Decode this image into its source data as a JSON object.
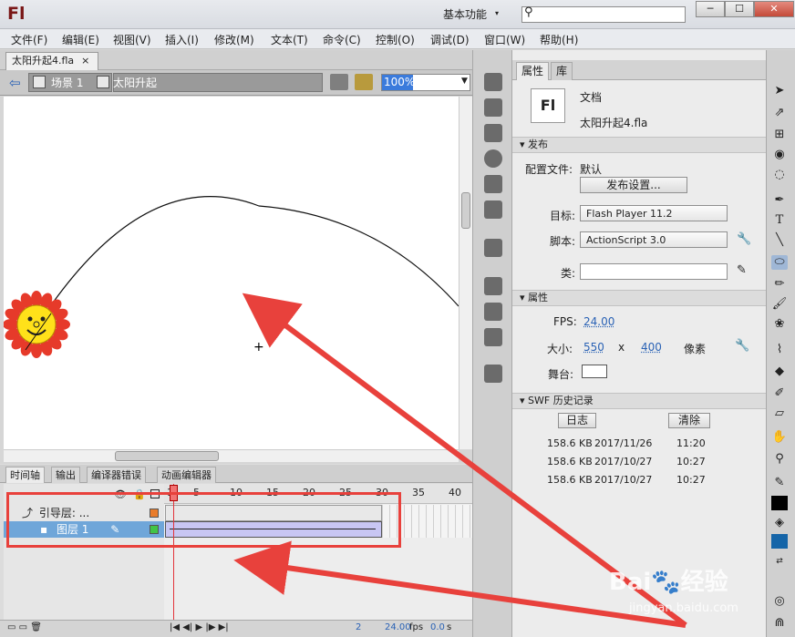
{
  "app": {
    "logo": "Fl",
    "workspace": "基本功能",
    "workspace_caret": "▾",
    "window_buttons": [
      "─",
      "☐",
      "✕"
    ]
  },
  "menu": [
    "文件(F)",
    "编辑(E)",
    "视图(V)",
    "插入(I)",
    "修改(M)",
    "文本(T)",
    "命令(C)",
    "控制(O)",
    "调试(D)",
    "窗口(W)",
    "帮助(H)"
  ],
  "document": {
    "tab": "太阳升起4.fla",
    "close": "×"
  },
  "breadcrumb": {
    "scene": "场景 1",
    "symbol": "太阳升起",
    "zoom": "100%"
  },
  "timeline": {
    "tabs": [
      "时间轴",
      "输出",
      "编译器错误",
      "动画编辑器"
    ],
    "ruler": [
      "1",
      "5",
      "10",
      "15",
      "20",
      "25",
      "30",
      "35",
      "40"
    ],
    "layers": [
      {
        "name": "引导层: ...",
        "selected": false
      },
      {
        "name": "图层 1",
        "selected": true
      }
    ],
    "status": {
      "frame": "2",
      "fps": "24.00",
      "fps_unit": "fps",
      "time": "0.0",
      "time_unit": "s"
    }
  },
  "properties": {
    "tabs": [
      "属性",
      "库"
    ],
    "doc_type": "文档",
    "doc_name": "太阳升起4.fla",
    "doc_icon": "Fl",
    "publish": {
      "header": "发布",
      "profile_label": "配置文件:",
      "profile_value": "默认",
      "settings_button": "发布设置...",
      "target_label": "目标:",
      "target_value": "Flash Player 11.2",
      "script_label": "脚本:",
      "script_value": "ActionScript 3.0",
      "class_label": "类:",
      "class_value": ""
    },
    "props": {
      "header": "属性",
      "fps_label": "FPS:",
      "fps_value": "24.00",
      "size_label": "大小:",
      "width": "550",
      "x": "x",
      "height": "400",
      "unit": "像素",
      "stage_label": "舞台:",
      "stage_color": "#ffffff"
    },
    "swf": {
      "header": "SWF 历史记录",
      "log_button": "日志",
      "clear_button": "清除",
      "rows": [
        {
          "size": "158.6 KB",
          "date": "2017/11/26",
          "time": "11:20"
        },
        {
          "size": "158.6 KB",
          "date": "2017/10/27",
          "time": "10:27"
        },
        {
          "size": "158.6 KB",
          "date": "2017/10/27",
          "time": "10:27"
        }
      ]
    }
  },
  "watermark": {
    "brand": "Bai",
    "paw": "🐾",
    "brand2": "经验",
    "url": "jingyan.baidu.com"
  },
  "colors": {
    "accent": "#3b7bdc",
    "arrow": "#e8413c",
    "sun_petal": "#e63a2a",
    "sun_face": "#ffe11a",
    "selected_row": "#6fa6d9",
    "tween": "#c8c6f3",
    "playhead": "#e2333a"
  }
}
